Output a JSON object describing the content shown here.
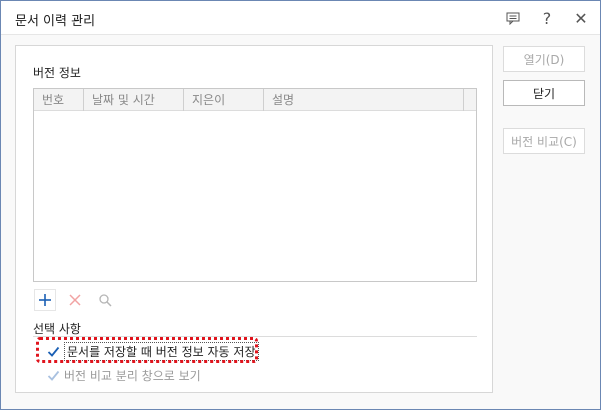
{
  "window": {
    "title": "문서 이력 관리"
  },
  "version_info": {
    "label": "버전 정보",
    "columns": [
      "번호",
      "날짜 및 시간",
      "지은이",
      "설명"
    ],
    "rows": []
  },
  "options": {
    "label": "선택 사항",
    "auto_save": {
      "label": "문서를 저장할 때 버전 정보 자동 저장",
      "checked": true
    },
    "compare_window": {
      "label": "버전 비교 분리 창으로 보기",
      "checked": true,
      "disabled": true
    }
  },
  "buttons": {
    "open": "열기(D)",
    "close": "닫기",
    "compare": "버전 비교(C)"
  },
  "colors": {
    "highlight": "#e0141d",
    "accent": "#1a5fb4",
    "delete_disabled": "#f1a3a3"
  }
}
